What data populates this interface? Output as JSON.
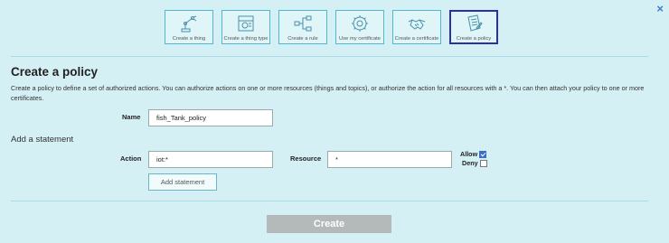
{
  "close": {
    "glyph": "×"
  },
  "wizard": {
    "steps": [
      {
        "label": "Create a thing",
        "icon": "robot-arm-icon",
        "active": false
      },
      {
        "label": "Create a thing type",
        "icon": "blueprint-icon",
        "active": false
      },
      {
        "label": "Create a rule",
        "icon": "flow-icon",
        "active": false
      },
      {
        "label": "Use my certificate",
        "icon": "certificate-gear-icon",
        "active": false
      },
      {
        "label": "Create a certificate",
        "icon": "handshake-icon",
        "active": false
      },
      {
        "label": "Create a policy",
        "icon": "document-pen-icon",
        "active": true
      }
    ]
  },
  "page": {
    "title": "Create a policy",
    "description": "Create a policy to define a set of authorized actions. You can authorize actions on one or more resources (things and topics), or authorize the action for all resources with a *. You can then attach your policy to one or more certificates."
  },
  "form": {
    "name_label": "Name",
    "name_value": "fish_Tank_policy",
    "statement_title": "Add a statement",
    "action_label": "Action",
    "action_value": "iot:*",
    "resource_label": "Resource",
    "resource_value": "*",
    "allow_label": "Allow",
    "allow_checked": true,
    "deny_label": "Deny",
    "deny_checked": false,
    "add_statement_label": "Add statement",
    "create_label": "Create"
  },
  "colors": {
    "background": "#d4f0f4",
    "step_border": "#4fb8d0",
    "active_step_border": "#2c2fa8",
    "create_button": "#b4b9ba"
  }
}
